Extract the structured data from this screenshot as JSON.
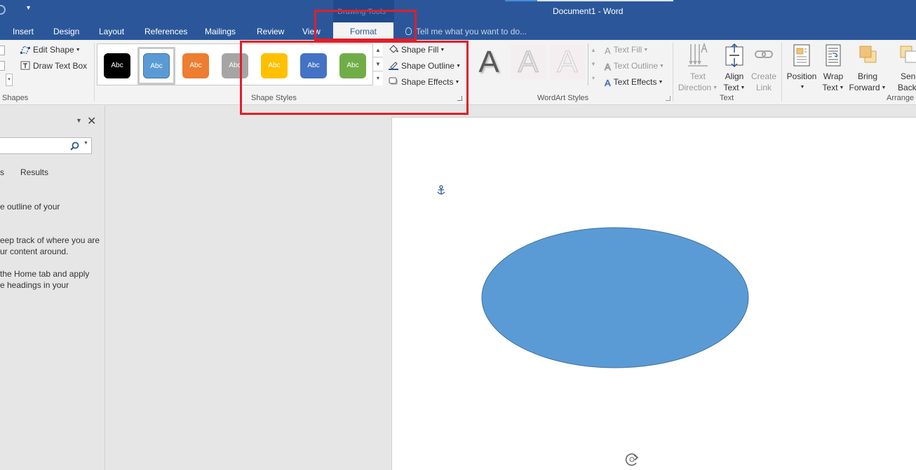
{
  "window": {
    "title": "Document1 - Word",
    "contextual_group": "Drawing Tools"
  },
  "tabs": [
    {
      "label": "Insert"
    },
    {
      "label": "Design"
    },
    {
      "label": "Layout"
    },
    {
      "label": "References"
    },
    {
      "label": "Mailings"
    },
    {
      "label": "Review"
    },
    {
      "label": "View"
    },
    {
      "label": "Format",
      "active": true
    }
  ],
  "tell_me": {
    "placeholder": "Tell me what you want to do..."
  },
  "ribbon": {
    "insert_shapes": {
      "edit_shape": "Edit Shape",
      "draw_text_box": "Draw Text Box",
      "label": "Shapes"
    },
    "shape_styles": {
      "label": "Shape Styles",
      "swatch_text": "Abc",
      "swatches": [
        {
          "color": "#000000",
          "text_color": "#ffffff"
        },
        {
          "color": "#5b9bd5",
          "text_color": "#ffffff",
          "selected": true
        },
        {
          "color": "#ed7d31",
          "text_color": "#ffffff"
        },
        {
          "color": "#a5a5a5",
          "text_color": "#ffffff"
        },
        {
          "color": "#ffc000",
          "text_color": "#ffffff"
        },
        {
          "color": "#4472c4",
          "text_color": "#ffffff"
        },
        {
          "color": "#70ad47",
          "text_color": "#ffffff"
        }
      ],
      "shape_fill": "Shape Fill",
      "shape_outline": "Shape Outline",
      "shape_effects": "Shape Effects"
    },
    "wordart_styles": {
      "label": "WordArt Styles",
      "letter": "A",
      "text_fill": "Text Fill",
      "text_outline": "Text Outline",
      "text_effects": "Text Effects"
    },
    "text": {
      "label": "Text",
      "text_direction": [
        "Text",
        "Direction"
      ],
      "align_text": [
        "Align",
        "Text"
      ],
      "create_link": [
        "Create",
        "Link"
      ]
    },
    "arrange": {
      "label": "Arrange",
      "position": "Position",
      "wrap_text": [
        "Wrap",
        "Text"
      ],
      "bring_forward": [
        "Bring",
        "Forward"
      ],
      "send_backward": [
        "Send",
        "Backward"
      ]
    }
  },
  "nav_pane": {
    "results_tab": "Results",
    "other_tab_fragment": "s",
    "lines": [
      "e outline of your",
      "eep track of where you are",
      "ur content around.",
      " the Home tab and apply",
      "e headings in your"
    ]
  },
  "colors": {
    "accent": "#2b579a",
    "shape_fill": "#5b9bd5",
    "shape_outline": "#41719c",
    "highlight": "#e31e28"
  }
}
